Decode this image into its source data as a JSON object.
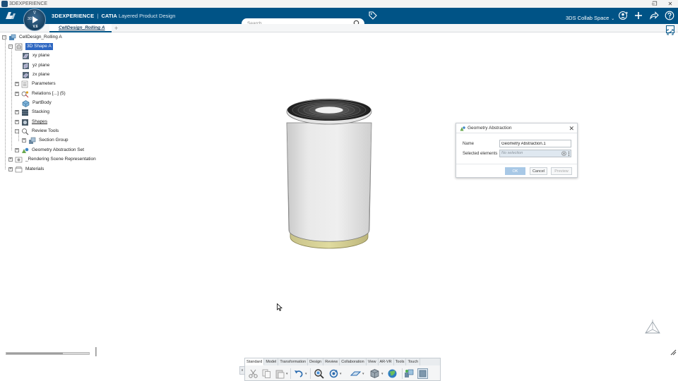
{
  "window": {
    "title": "3DEXPERIENCE",
    "minimize_glyph": "–",
    "restore_glyph": "❐",
    "close_glyph": "✕"
  },
  "header": {
    "compass_version": "V.6",
    "compass_3d": "3D",
    "compass_top": "∇",
    "brand_primary": "3DEXPERIENCE",
    "brand_separator": "|",
    "brand_app": "CATIA",
    "brand_module": "Layered Product Design",
    "search_placeholder": "Search",
    "collab_space": "3DS Collab Space",
    "collab_caret": "⌄"
  },
  "tabs": {
    "active_tab": "CellDesign_Rolling A",
    "add_glyph": "+"
  },
  "tree": {
    "expand_open": "−",
    "expand_closed": "+",
    "items": [
      {
        "label": "CellDesign_Rolling A"
      },
      {
        "label": "3D Shape A"
      },
      {
        "label": "xy plane"
      },
      {
        "label": "yz plane"
      },
      {
        "label": "zx plane"
      },
      {
        "label": "Parameters"
      },
      {
        "label": "Relations [...] (5)"
      },
      {
        "label": "PartBody"
      },
      {
        "label": "Stacking"
      },
      {
        "label": "Shapes"
      },
      {
        "label": "Review Tools"
      },
      {
        "label": "Section Group"
      },
      {
        "label": "Geometry Abstraction Set"
      },
      {
        "label": "_Rendering Scene Representation"
      },
      {
        "label": "Materials"
      }
    ]
  },
  "dialog": {
    "title": "Geometry Abstraction",
    "close_glyph": "✕",
    "name_label": "Name",
    "name_value": "Geometry Abstraction.1",
    "selected_label": "Selected elements",
    "selected_value": "No selection",
    "ok_label": "OK",
    "cancel_label": "Cancel",
    "preview_label": "Preview"
  },
  "slider": {
    "value_fraction": 0.68
  },
  "action_bar": {
    "collapse_glyph": "∨",
    "dropdown_glyph": "▾",
    "tabs": [
      "Standard",
      "Model",
      "Transformation",
      "Design",
      "Review",
      "Collaboration",
      "View",
      "AR-VR",
      "Tools",
      "Touch"
    ],
    "active_tab": "Standard"
  },
  "colors": {
    "header_bg": "#005386",
    "selection": "#2d66c1",
    "cylinder_body": "#e2e2e2",
    "cylinder_base": "#d9d49a",
    "cylinder_top": "#2a2a2a"
  }
}
